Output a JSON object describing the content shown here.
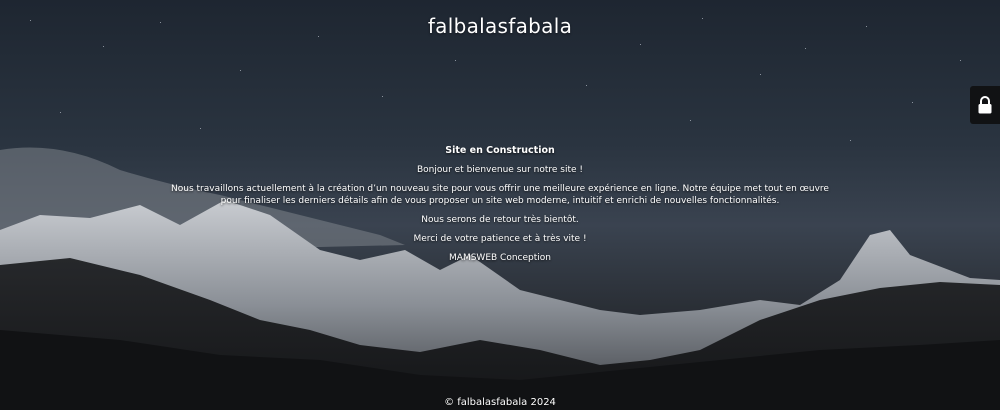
{
  "site": {
    "title": "falbalasfabala"
  },
  "content": {
    "heading": "Site en Construction",
    "greeting": "Bonjour et bienvenue sur notre site !",
    "paragraph": "Nous travaillons actuellement à la création d’un nouveau site pour vous offrir une meilleure expérience en ligne. Notre équipe met tout en œuvre pour finaliser les derniers détails afin de vous proposer un site web moderne, intuitif et enrichi de nouvelles fonctionnalités.",
    "return_notice": "Nous serons de retour très bientôt.",
    "thanks": "Merci de votre patience et à très vite !",
    "signature": "MAMSWEB Conception"
  },
  "footer": {
    "copyright": "© falbalasfabala 2024"
  },
  "lock_tab": {
    "icon": "lock-icon"
  },
  "colors": {
    "sky_top": "#1e2631",
    "text": "#ffffff",
    "lock_tab_bg": "#111214"
  }
}
